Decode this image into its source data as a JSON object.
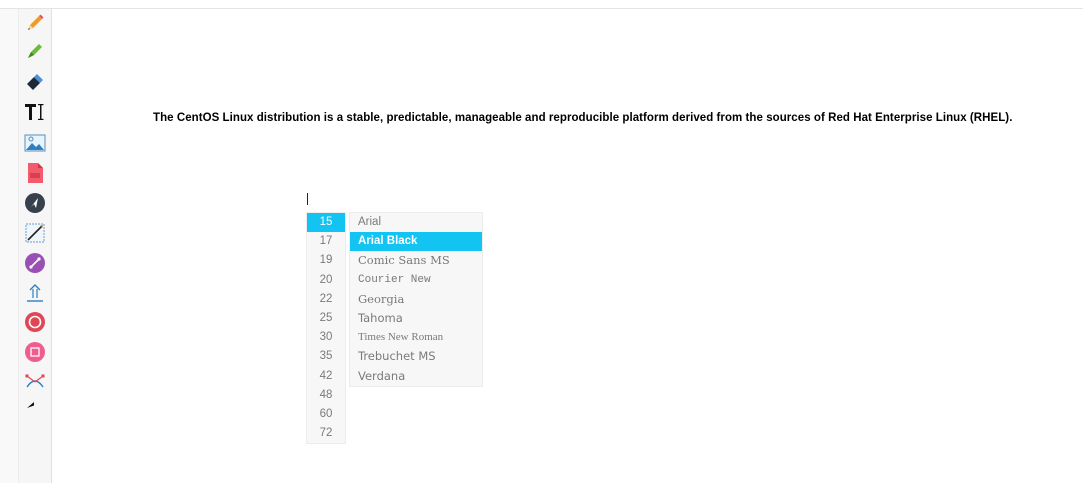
{
  "tools": [
    {
      "name": "pencil-icon",
      "label": "Pencil"
    },
    {
      "name": "marker-icon",
      "label": "Marker"
    },
    {
      "name": "eraser-icon",
      "label": "Eraser"
    },
    {
      "name": "text-tool-icon",
      "label": "Text"
    },
    {
      "name": "image-icon",
      "label": "Image"
    },
    {
      "name": "pdf-icon",
      "label": "PDF"
    },
    {
      "name": "pointer-icon",
      "label": "Pointer"
    },
    {
      "name": "line-icon",
      "label": "Line"
    },
    {
      "name": "arrow-line-icon",
      "label": "Arrow"
    },
    {
      "name": "upload-icon",
      "label": "Upload"
    },
    {
      "name": "circle-icon",
      "label": "Circle"
    },
    {
      "name": "rectangle-icon",
      "label": "Rectangle"
    },
    {
      "name": "bezier-icon",
      "label": "Bezier"
    },
    {
      "name": "undo-icon",
      "label": "Undo"
    }
  ],
  "canvas": {
    "text": "The CentOS Linux distribution is a stable, predictable, manageable and reproducible platform derived from the sources of Red Hat Enterprise Linux (RHEL)."
  },
  "font_sizes": {
    "selected": "15",
    "options": [
      "15",
      "17",
      "19",
      "20",
      "22",
      "25",
      "30",
      "35",
      "42",
      "48",
      "60",
      "72"
    ]
  },
  "font_families": {
    "selected": "Arial Black",
    "options": [
      "Arial",
      "Arial Black",
      "Comic Sans MS",
      "Courier New",
      "Georgia",
      "Tahoma",
      "Times New Roman",
      "Trebuchet MS",
      "Verdana"
    ]
  },
  "colors": {
    "accent": "#13c4f2"
  }
}
